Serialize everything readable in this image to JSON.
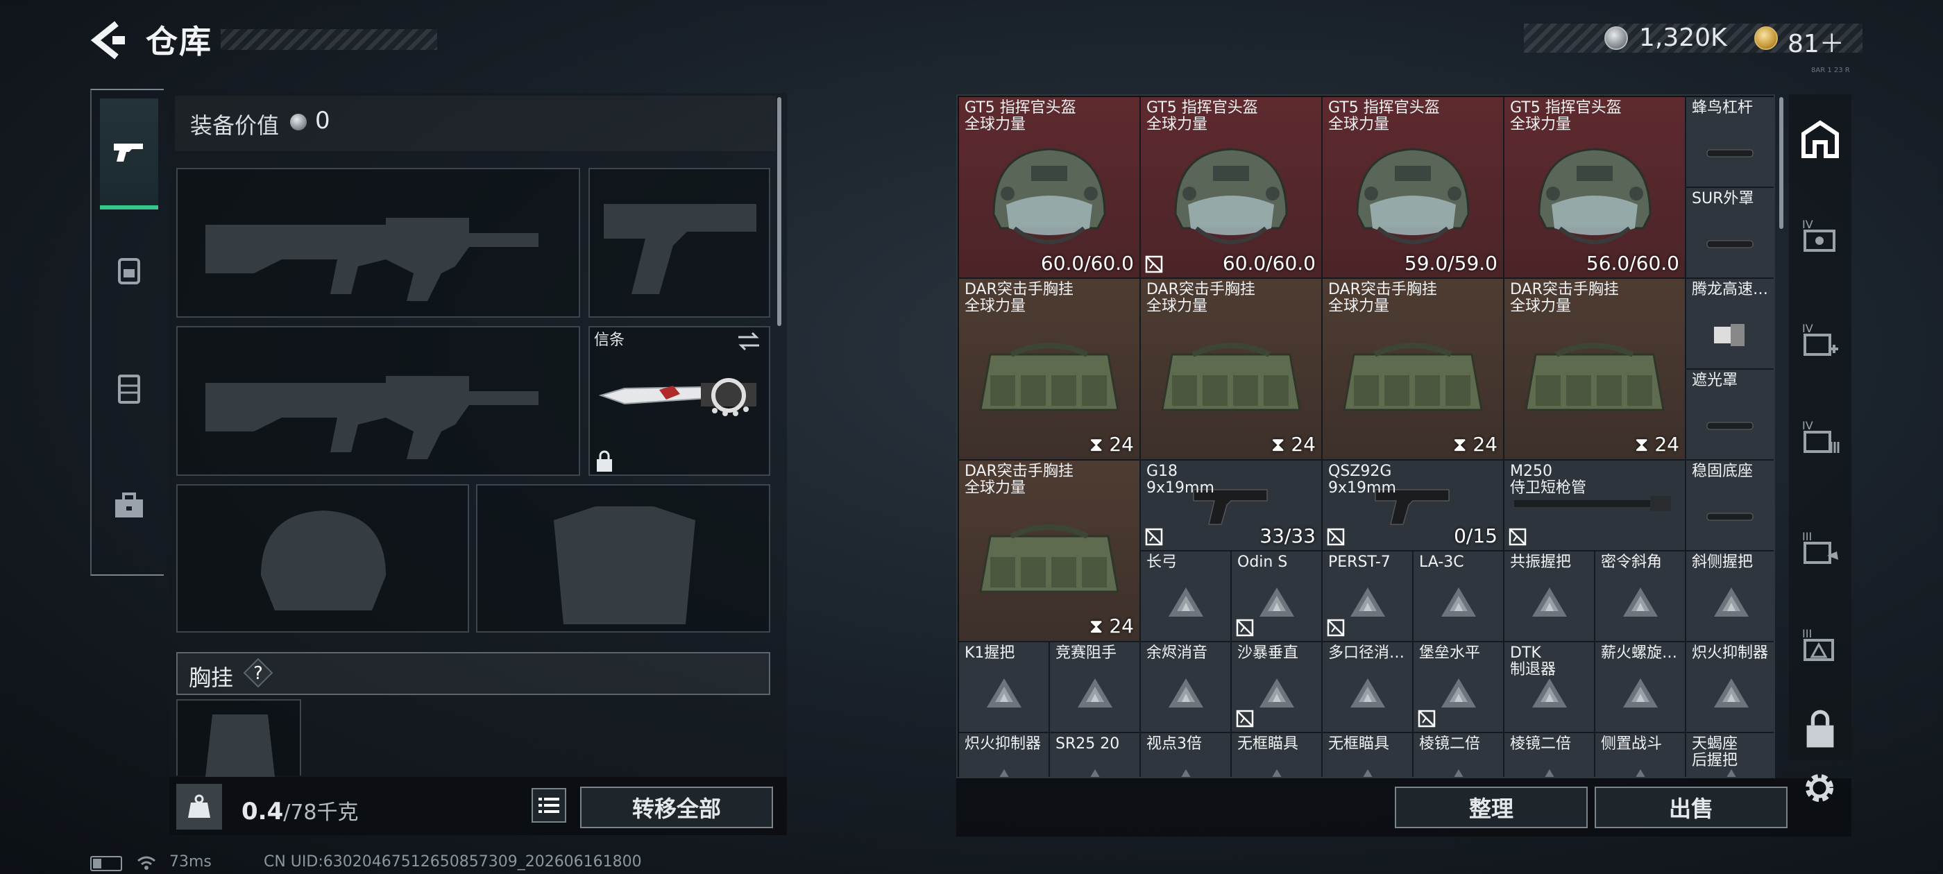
{
  "header": {
    "title": "仓库",
    "currency1": "1,320K",
    "currency2": "81＋",
    "tiny": "8AR 1 23 R"
  },
  "equipment": {
    "label": "装备价值",
    "value": "0"
  },
  "knife_slot": {
    "label": "信条"
  },
  "vest": {
    "label": "胸挂",
    "help": "?"
  },
  "weight": {
    "current": "0.4",
    "max": "/78千克"
  },
  "buttons": {
    "transfer_all": "转移全部",
    "sort": "整理",
    "sell": "出售"
  },
  "status": {
    "ping": "73ms",
    "uid": "CN UID:63020467512650857309_202606161800"
  },
  "stash": {
    "helmets": [
      {
        "name": "GT5 指挥官头盔\n全球力量",
        "value": "60.0/60.0",
        "locked": false
      },
      {
        "name": "GT5 指挥官头盔\n全球力量",
        "value": "60.0/60.0",
        "locked": true
      },
      {
        "name": "GT5 指挥官头盔\n全球力量",
        "value": "59.0/59.0",
        "locked": false
      },
      {
        "name": "GT5 指挥官头盔\n全球力量",
        "value": "56.0/60.0",
        "locked": false
      }
    ],
    "rigs": [
      {
        "name": "DAR突击手胸挂\n全球力量",
        "value": "24"
      },
      {
        "name": "DAR突击手胸挂\n全球力量",
        "value": "24"
      },
      {
        "name": "DAR突击手胸挂\n全球力量",
        "value": "24"
      },
      {
        "name": "DAR突击手胸挂\n全球力量",
        "value": "24"
      },
      {
        "name": "DAR突击手胸挂\n全球力量",
        "value": "24"
      }
    ],
    "side_column": [
      "蜂鸟杠杆",
      "SUR外罩",
      "腾龙高速…",
      "遮光罩",
      "稳固底座"
    ],
    "guns": [
      {
        "name": "G18\n9x19mm",
        "value": "33/33"
      },
      {
        "name": "QSZ92G\n9x19mm",
        "value": "0/15"
      },
      {
        "name": "M250\n侍卫短枪管",
        "value": ""
      }
    ],
    "row4": [
      "长弓",
      "Odin S",
      "PERST-7",
      "LA-3C",
      "共振握把",
      "密令斜角",
      "斜侧握把"
    ],
    "row5": [
      "K1握把",
      "竞赛阻手",
      "余烬消音",
      "沙暴垂直",
      "多口径消…",
      "堡垒水平",
      "DTK\n制退器",
      "薪火螺旋…",
      "炽火抑制器"
    ],
    "row6": [
      "炽火抑制器",
      "SR25 20",
      "视点3倍",
      "无框瞄具",
      "无框瞄具",
      "棱镜二倍",
      "棱镜二倍",
      "侧置战斗",
      "天蝎座\n后握把"
    ]
  },
  "right_tabs": [
    "IV",
    "IV",
    "IV",
    "III",
    "III"
  ]
}
